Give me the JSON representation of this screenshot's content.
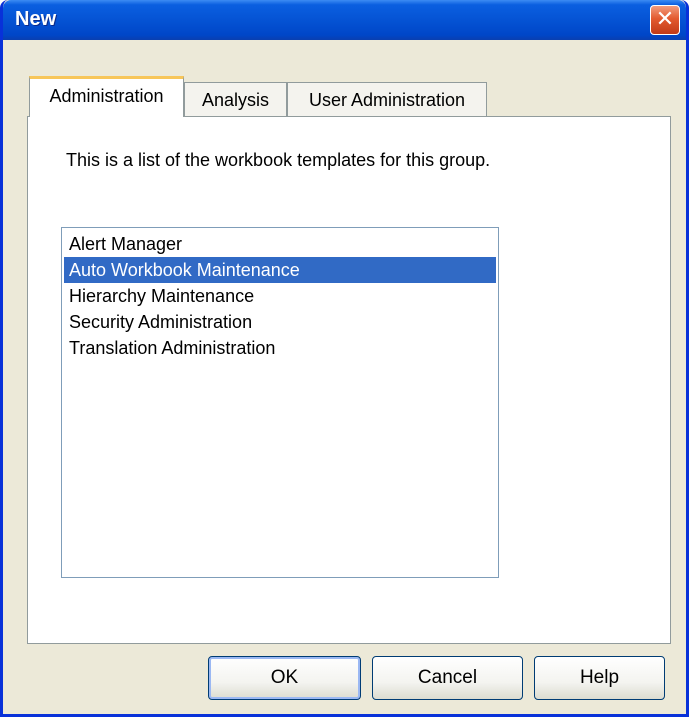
{
  "window": {
    "title": "New",
    "close_symbol": "✕"
  },
  "tabs": [
    {
      "label": "Administration",
      "active": true
    },
    {
      "label": "Analysis",
      "active": false
    },
    {
      "label": "User Administration",
      "active": false
    }
  ],
  "panel": {
    "description": "This is a list of the workbook templates for this group."
  },
  "templates": {
    "items": [
      {
        "label": "Alert Manager",
        "selected": false
      },
      {
        "label": "Auto Workbook Maintenance",
        "selected": true
      },
      {
        "label": "Hierarchy Maintenance",
        "selected": false
      },
      {
        "label": "Security Administration",
        "selected": false
      },
      {
        "label": "Translation Administration",
        "selected": false
      }
    ]
  },
  "buttons": {
    "ok": "OK",
    "cancel": "Cancel",
    "help": "Help"
  },
  "colors": {
    "selection": "#316ac5",
    "titlebar": "#0553d4",
    "active_tab_accent": "#f7c65a"
  },
  "icons": {
    "close": "close-icon"
  }
}
